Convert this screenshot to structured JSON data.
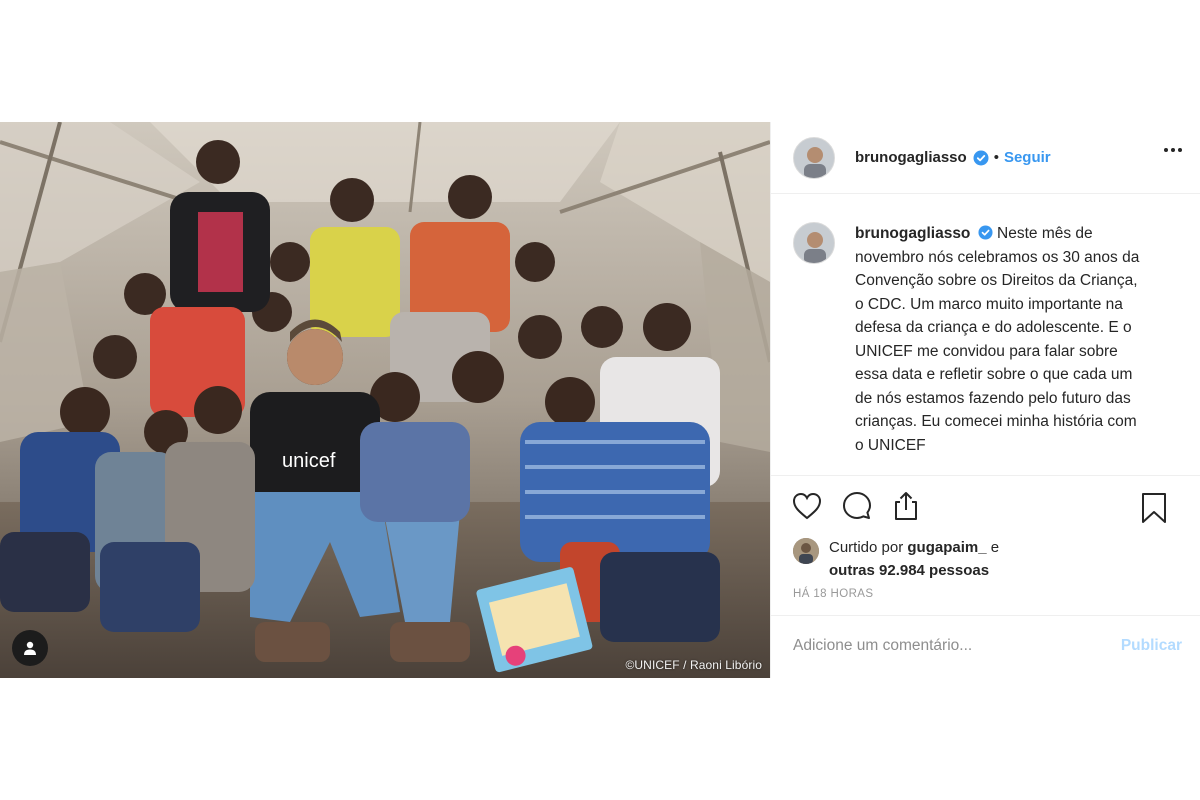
{
  "post": {
    "username": "brunogagliasso",
    "follow_label": "Seguir",
    "separator": "•",
    "photo_credit": "©UNICEF / Raoni Libório",
    "caption": "Neste mês de novembro nós celebramos os 30 anos da Convenção sobre os Direitos da Criança, o CDC. Um marco muito importante na defesa da criança e do adolescente. E o UNICEF me convidou para falar sobre essa data e refletir sobre o que cada um de nós estamos fazendo pelo futuro das crianças. Eu comecei minha história com o UNICEF",
    "likes_prefix": "Curtido por",
    "likes_user": "gugapaim_",
    "likes_and": "e",
    "likes_others": "outras 92.984 pessoas",
    "timestamp": "HÁ 18 HORAS",
    "comment_placeholder": "Adicione um comentário...",
    "publish_label": "Publicar"
  },
  "icons": {
    "verified": "verified-badge-icon",
    "more": "more-options-icon",
    "like": "heart-icon",
    "comment": "comment-icon",
    "share": "share-icon",
    "save": "bookmark-icon",
    "user_tag": "user-tag-icon"
  },
  "colors": {
    "accent": "#3897f0",
    "publish_disabled": "#b3dbff",
    "border": "#efefef",
    "muted": "#999999"
  }
}
